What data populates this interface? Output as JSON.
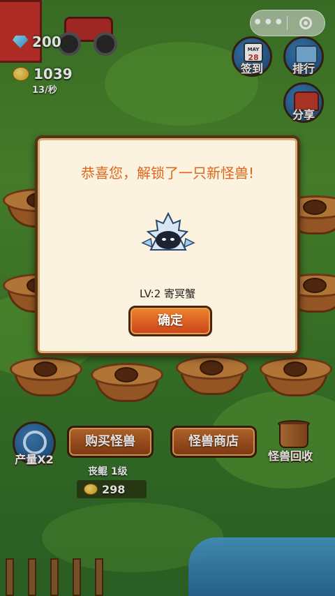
{
  "hud": {
    "gems": "200",
    "gold": "1039",
    "gold_rate": "13/秒"
  },
  "miniprogram_capsule": {
    "more_glyph": "•••",
    "close_icon": "record-circle-icon"
  },
  "side_buttons": {
    "checkin": {
      "label": "签到",
      "calendar_month": "MAY",
      "calendar_day": "28"
    },
    "rank": {
      "label": "排行"
    },
    "share": {
      "label": "分享"
    }
  },
  "modal": {
    "title": "恭喜您，解锁了一只新怪兽!",
    "level_text": "LV:2 寄冥蟹",
    "confirm_label": "确定"
  },
  "bottom": {
    "boost_label": "产量X2",
    "buy_label": "购买怪兽",
    "shop_label": "怪兽商店",
    "recycle_label": "怪兽回收",
    "next_monster": "丧鲲 1级",
    "price": "298"
  },
  "colors": {
    "modal_title": "#e0661c",
    "button_orange": "#f0842d",
    "grass": "#4f8d2f"
  }
}
